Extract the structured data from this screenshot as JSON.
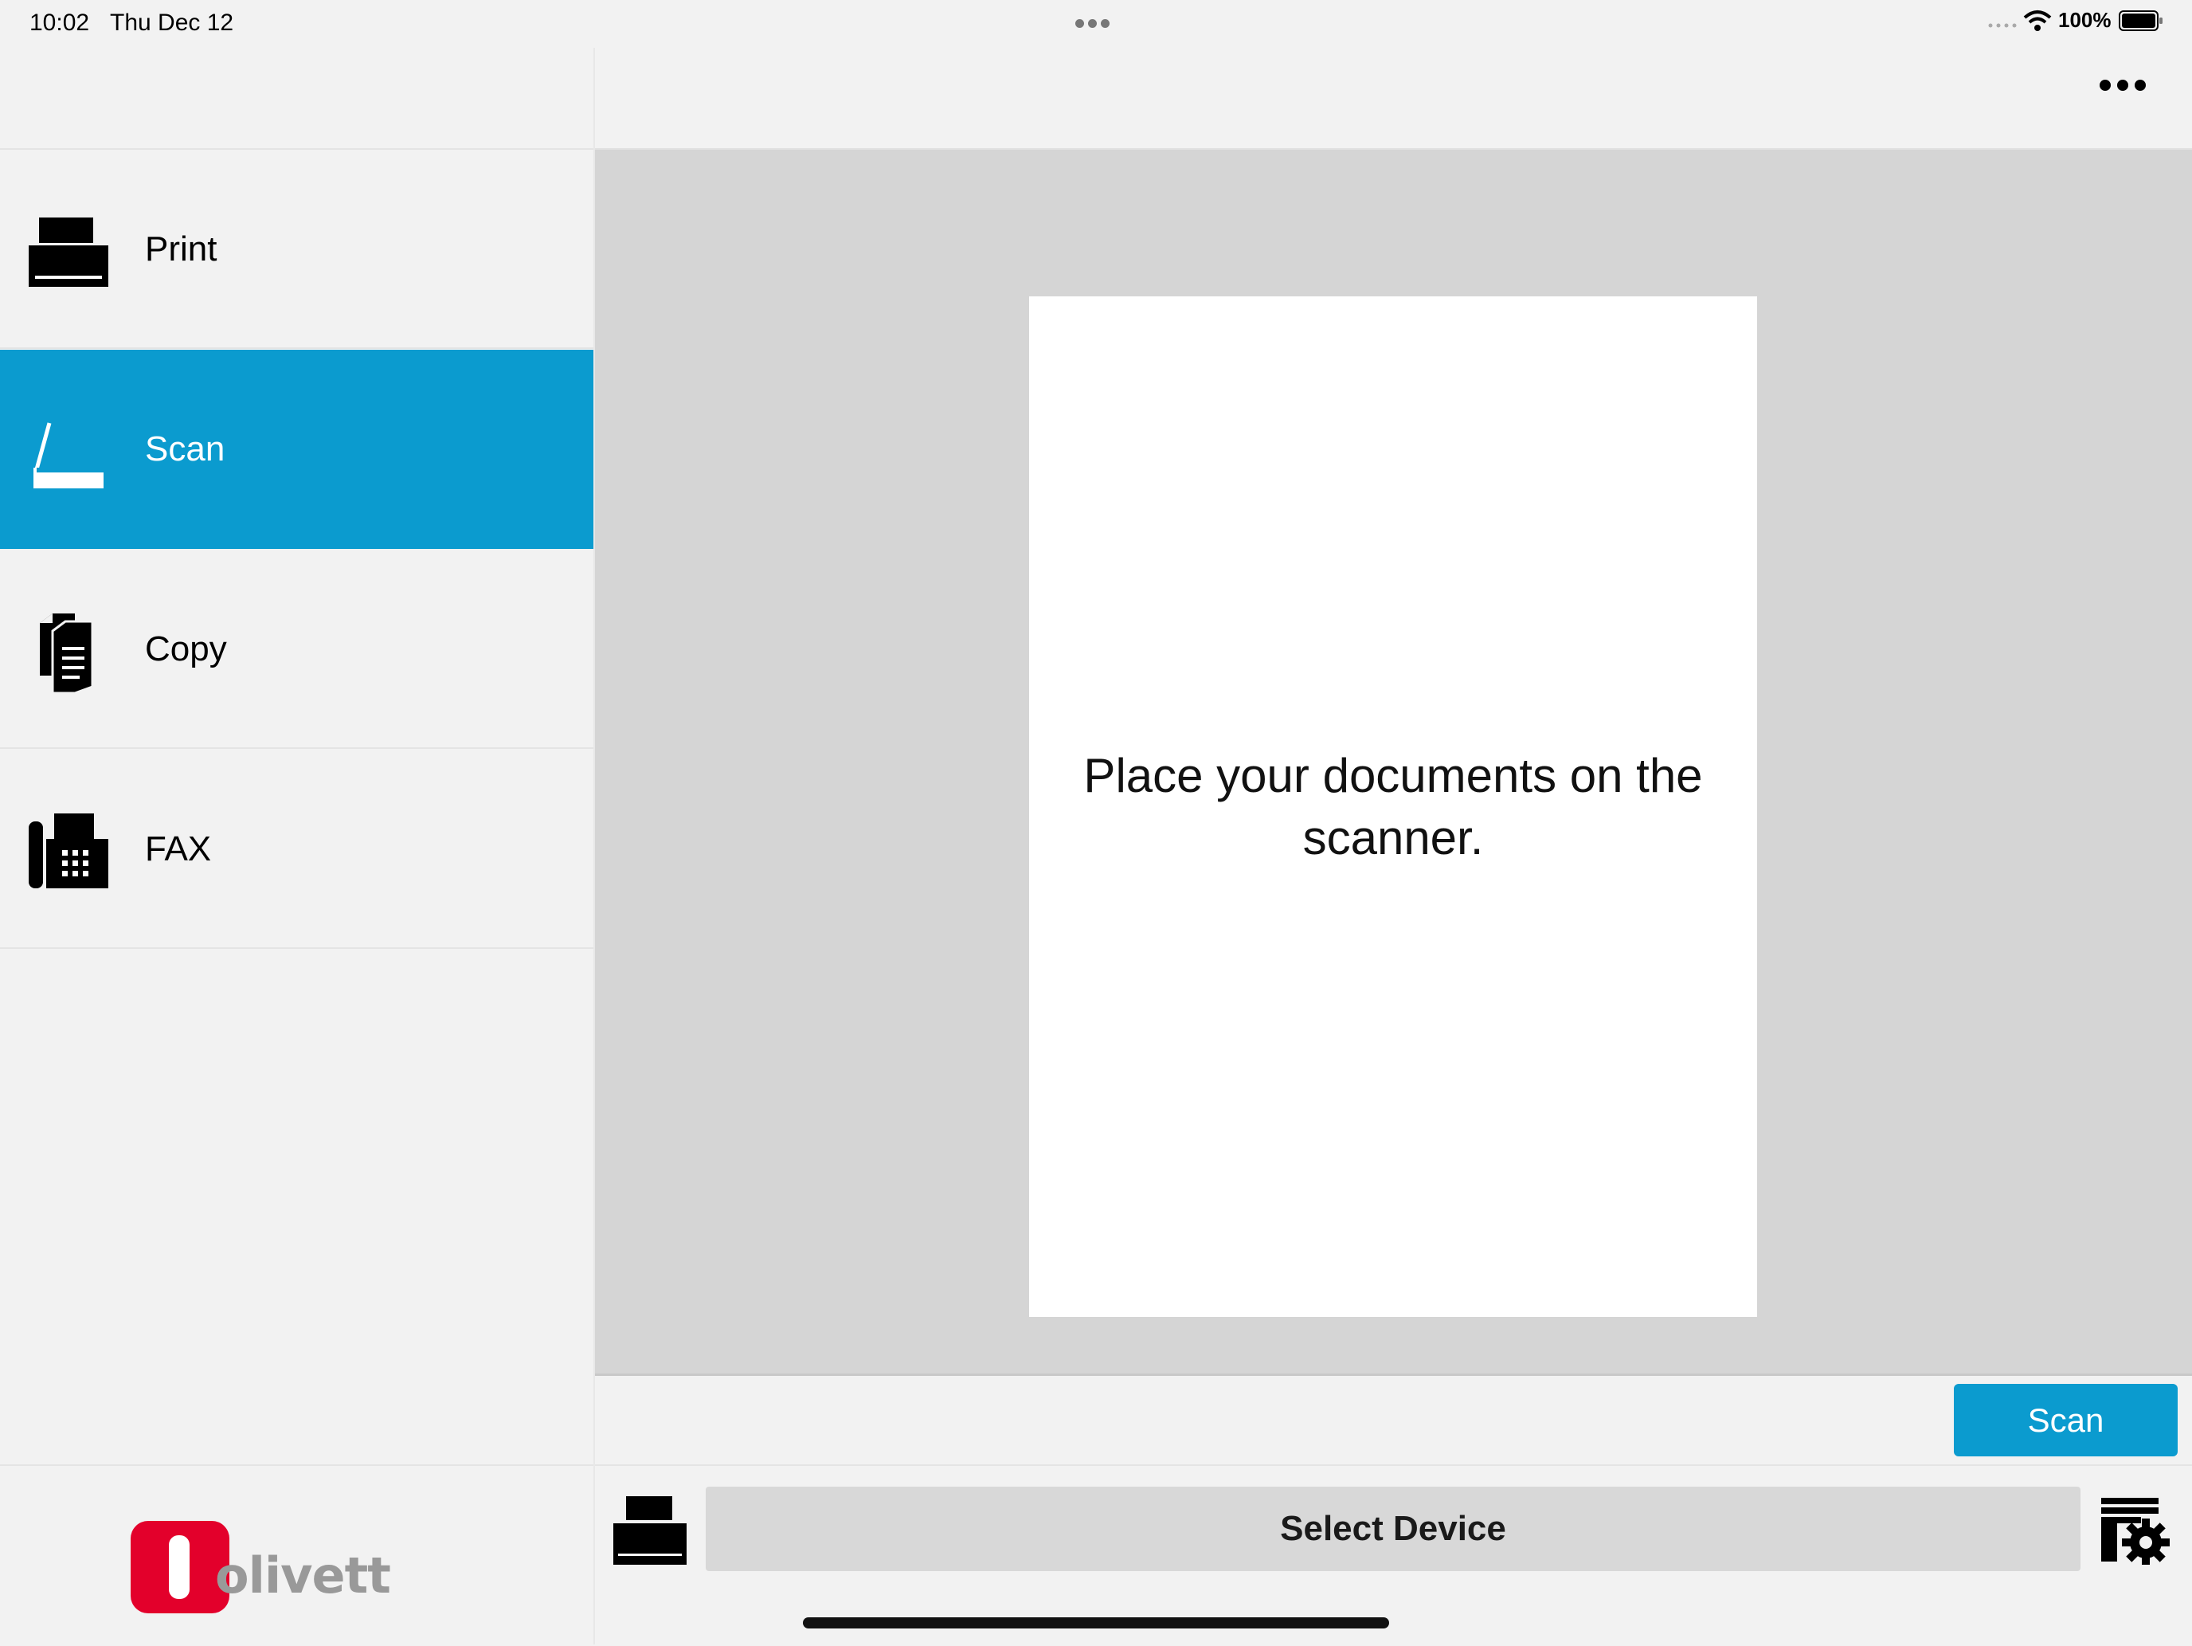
{
  "status_bar": {
    "time": "10:02",
    "date": "Thu Dec 12",
    "battery_percent": "100%",
    "icons": [
      "multitask-dots-icon",
      "cellular-dots-icon",
      "wifi-icon",
      "battery-icon"
    ]
  },
  "sidebar": {
    "items": [
      {
        "label": "Print",
        "icon": "printer-icon",
        "active": false
      },
      {
        "label": "Scan",
        "icon": "scanner-icon",
        "active": true
      },
      {
        "label": "Copy",
        "icon": "copy-icon",
        "active": false
      },
      {
        "label": "FAX",
        "icon": "fax-icon",
        "active": false
      }
    ],
    "logo_text": "olivetti"
  },
  "header": {
    "more_icon": "ellipsis-icon"
  },
  "preview": {
    "message": "Place your documents on the scanner."
  },
  "actions": {
    "scan_label": "Scan"
  },
  "device_bar": {
    "select_device_label": "Select Device",
    "device_icon": "printer-icon",
    "settings_icon": "device-settings-icon"
  },
  "colors": {
    "accent": "#0b9bcf",
    "background": "#f2f2f2",
    "preview_background": "#d5d5d5",
    "logo_red": "#e3002b"
  }
}
